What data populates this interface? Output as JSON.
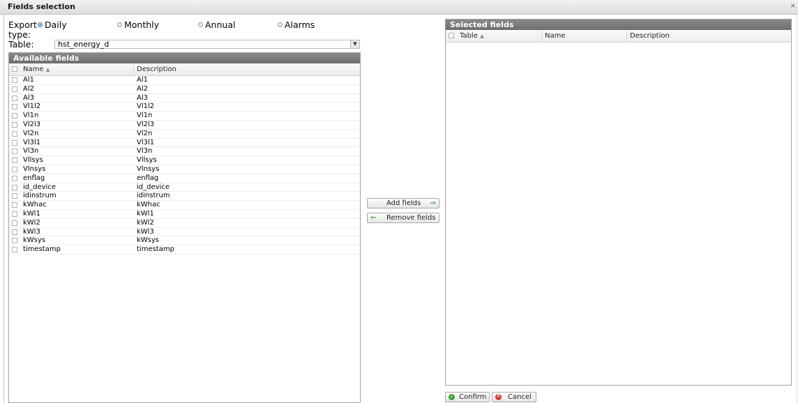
{
  "window": {
    "title": "Fields selection",
    "close_glyph": "×"
  },
  "export_type": {
    "label_line1": "Export",
    "label_line2": "type:",
    "options": [
      {
        "label": "Daily",
        "selected": true
      },
      {
        "label": "Monthly",
        "selected": false
      },
      {
        "label": "Annual",
        "selected": false
      },
      {
        "label": "Alarms",
        "selected": false
      }
    ]
  },
  "table": {
    "label": "Table:",
    "value": "hst_energy_d"
  },
  "available": {
    "title": "Available fields",
    "columns": {
      "name": "Name",
      "description": "Description"
    },
    "rows": [
      {
        "name": "Al1",
        "description": "Al1"
      },
      {
        "name": "Al2",
        "description": "Al2"
      },
      {
        "name": "Al3",
        "description": "Al3"
      },
      {
        "name": "Vl1l2",
        "description": "Vl1l2"
      },
      {
        "name": "Vl1n",
        "description": "Vl1n"
      },
      {
        "name": "Vl2l3",
        "description": "Vl2l3"
      },
      {
        "name": "Vl2n",
        "description": "Vl2n"
      },
      {
        "name": "Vl3l1",
        "description": "Vl3l1"
      },
      {
        "name": "Vl3n",
        "description": "Vl3n"
      },
      {
        "name": "Vllsys",
        "description": "Vllsys"
      },
      {
        "name": "Vlnsys",
        "description": "Vlnsys"
      },
      {
        "name": "enflag",
        "description": "enflag"
      },
      {
        "name": "id_device",
        "description": "id_device"
      },
      {
        "name": "idinstrum",
        "description": "idinstrum"
      },
      {
        "name": "kWhac",
        "description": "kWhac"
      },
      {
        "name": "kWl1",
        "description": "kWl1"
      },
      {
        "name": "kWl2",
        "description": "kWl2"
      },
      {
        "name": "kWl3",
        "description": "kWl3"
      },
      {
        "name": "kWsys",
        "description": "kWsys"
      },
      {
        "name": "timestamp",
        "description": "timestamp"
      }
    ]
  },
  "actions": {
    "add_label": "Add fields",
    "remove_label": "Remove fields"
  },
  "selected": {
    "title": "Selected fields",
    "columns": {
      "table": "Table",
      "name": "Name",
      "description": "Description"
    }
  },
  "footer": {
    "confirm_label": "Confirm",
    "cancel_label": "Cancel"
  },
  "colors": {
    "header_gray": "#7a7a7a",
    "radio_on": "#5a8fd0",
    "confirm_green": "#3ba03b",
    "cancel_red": "#d23a3a"
  },
  "icons": [
    "close-icon",
    "radio-icon",
    "dropdown-arrow-icon",
    "sort-arrow-icon",
    "arrow-right-icon",
    "arrow-left-icon",
    "confirm-icon",
    "cancel-icon"
  ]
}
